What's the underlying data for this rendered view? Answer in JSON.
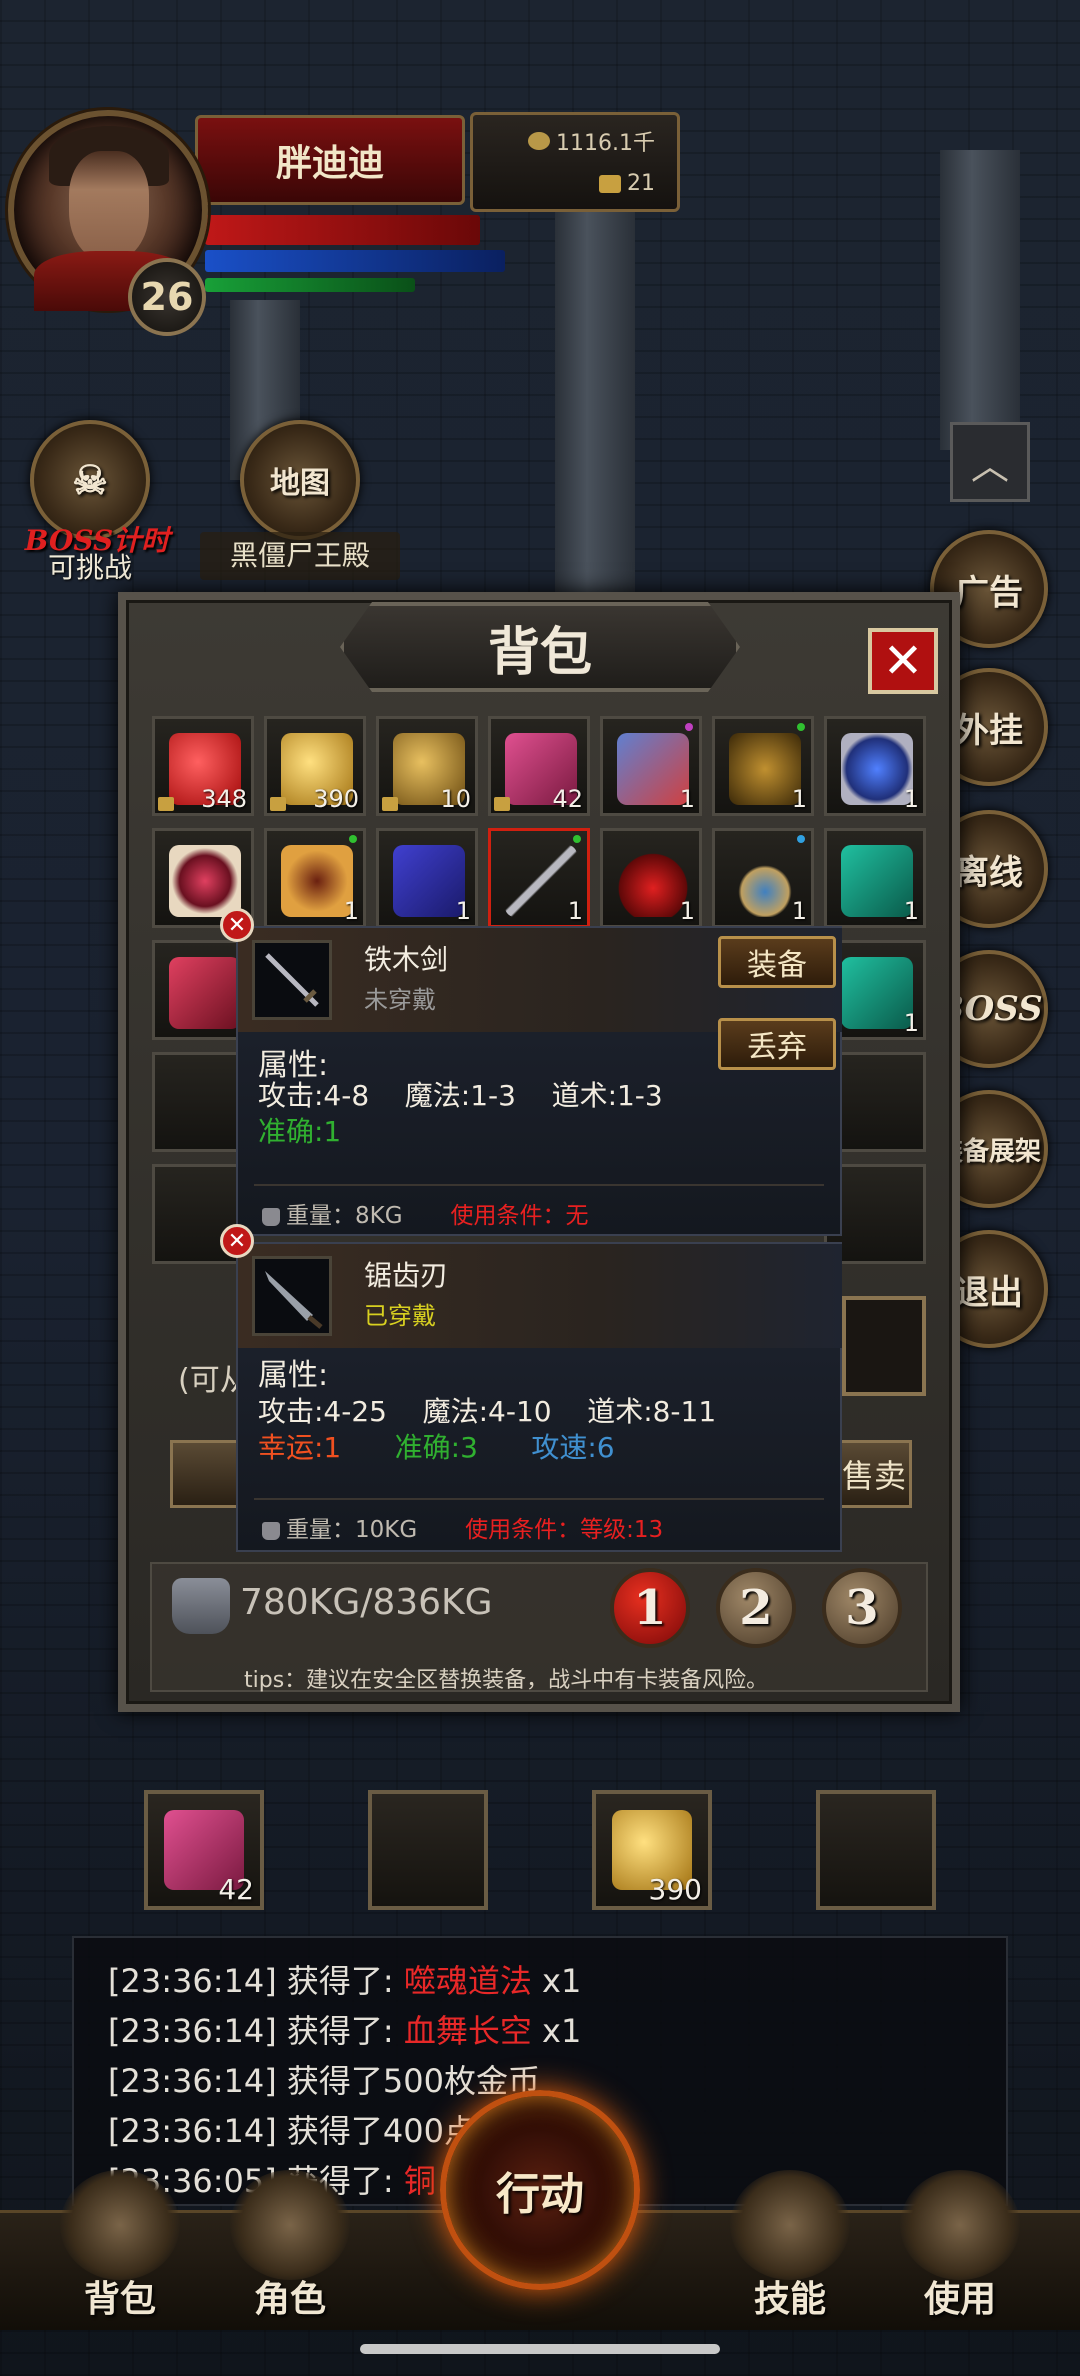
{
  "player": {
    "name": "胖迪迪",
    "level": "26",
    "gold": "1116.1千",
    "ingot": "21",
    "hp_fill": 0.9,
    "mp_fill": 0.95,
    "xp_fill": 0.55
  },
  "left_buttons": {
    "boss_timer_label": "BOSS计时",
    "boss_status": "可挑战",
    "map_icon_text": "地图",
    "map_location": "黑僵尸王殿"
  },
  "right_buttons": [
    "广告",
    "外挂",
    "离线",
    "BOSS",
    "装备展架",
    "退出"
  ],
  "collapse_icon": "chevron-up-icon",
  "bag": {
    "title": "背包",
    "close_label": "✕",
    "rows": [
      [
        {
          "item": "red-potion",
          "count": "348",
          "locked": true
        },
        {
          "item": "gold-potion",
          "count": "390",
          "locked": true
        },
        {
          "item": "gold-ore",
          "count": "10",
          "locked": true
        },
        {
          "item": "scroll-pink",
          "count": "42",
          "locked": true
        },
        {
          "item": "cloth-armor",
          "count": "1",
          "dot": "#c040c0"
        },
        {
          "item": "skull-charm",
          "count": "1",
          "dot": "#30c030"
        },
        {
          "item": "sapphire-ring",
          "count": "1"
        }
      ],
      [
        {
          "item": "ruby-ring",
          "count": ""
        },
        {
          "item": "gold-ring",
          "count": "1",
          "dot": "#30c030"
        },
        {
          "item": "blue-book",
          "count": "1"
        },
        {
          "item": "iron-sword",
          "count": "1",
          "selected": true,
          "dot": "#30c030"
        },
        {
          "item": "red-potion-small",
          "count": "1"
        },
        {
          "item": "amulet",
          "count": "1",
          "dot": "#30a0e0"
        },
        {
          "item": "green-book",
          "count": "1"
        }
      ],
      [
        {
          "item": "red-book",
          "count": ""
        },
        {
          "item": "",
          "count": ""
        },
        {
          "item": "",
          "count": ""
        },
        {
          "item": "",
          "count": ""
        },
        {
          "item": "",
          "count": ""
        },
        {
          "item": "",
          "count": ""
        },
        {
          "item": "green-book",
          "count": "1"
        }
      ]
    ],
    "partial_text_left": "(可从",
    "partial_text_sell": "售卖",
    "weight": "780KG/836KG",
    "pages": [
      "1",
      "2",
      "3"
    ],
    "active_page": "1",
    "tips": "tips：建议在安全区替换装备，战斗中有卡装备风险。"
  },
  "tooltip_new": {
    "name": "铁木剑",
    "state": "未穿戴",
    "state_color": "#9a9a9a",
    "attr_title": "属性:",
    "attack": "攻击:4-8",
    "magic": "魔法:1-3",
    "taoism": "道术:1-3",
    "accuracy": "准确:1",
    "weight": "重量：8KG",
    "requirement": "使用条件：无",
    "equip_label": "装备",
    "discard_label": "丢弃"
  },
  "tooltip_worn": {
    "name": "锯齿刃",
    "state": "已穿戴",
    "state_color": "#d8d020",
    "attr_title": "属性:",
    "attack": "攻击:4-25",
    "magic": "魔法:4-10",
    "taoism": "道术:8-11",
    "luck": "幸运:1",
    "accuracy": "准确:3",
    "speed": "攻速:6",
    "weight": "重量：10KG",
    "requirement": "使用条件：等级:13"
  },
  "quick_slots": [
    {
      "item": "scroll-pink",
      "count": "42"
    },
    {
      "item": "",
      "count": ""
    },
    {
      "item": "gold-potion",
      "count": "390"
    },
    {
      "item": "",
      "count": ""
    }
  ],
  "chat": [
    {
      "prefix": "[23:36:14] 获得了: ",
      "item": "噬魂道法",
      "suffix": " x1"
    },
    {
      "prefix": "[23:36:14] 获得了: ",
      "item": "血舞长空",
      "suffix": " x1"
    },
    {
      "prefix": "[23:36:14] 获得了500枚金币",
      "item": "",
      "suffix": ""
    },
    {
      "prefix": "[23:36:14] 获得了400点",
      "item": "",
      "suffix": ""
    },
    {
      "prefix": "[23:36:05] 获得了: ",
      "item": "铜",
      "suffix": ""
    }
  ],
  "bottom_nav": {
    "bag": "背包",
    "character": "角色",
    "action": "行动",
    "skills": "技能",
    "use": "使用"
  },
  "colors": {
    "rare_item": "#e82828",
    "luck": "#f05020",
    "accuracy": "#30b030",
    "speed": "#4090d0",
    "requirement": "#e82020"
  }
}
